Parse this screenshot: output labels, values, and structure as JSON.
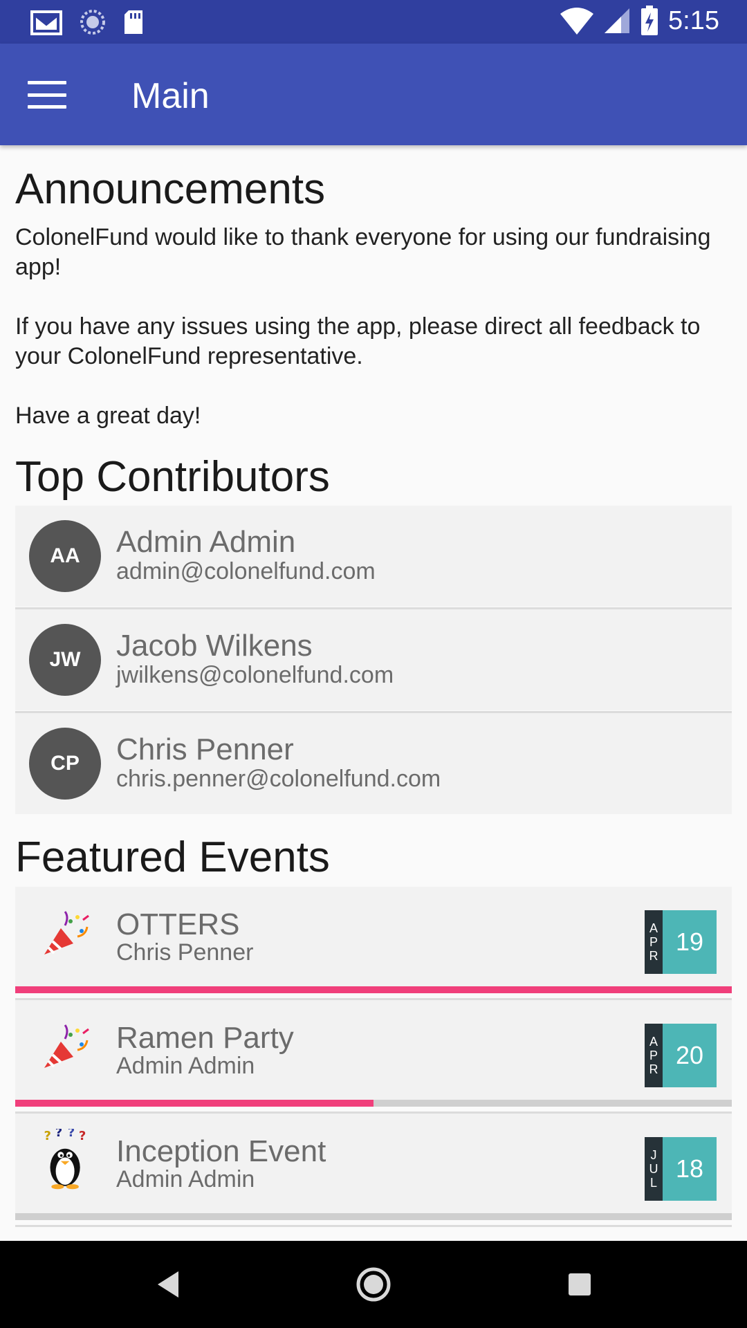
{
  "status_bar": {
    "time": "5:15",
    "icons": [
      "gmail-icon",
      "sync-icon",
      "sd-card-icon",
      "wifi-icon",
      "signal-icon",
      "battery-charging-icon"
    ]
  },
  "app_bar": {
    "title": "Main",
    "menu_icon": "hamburger-menu-icon",
    "bg_color": "#3f51b5",
    "status_bg_color": "#303f9f"
  },
  "announcements": {
    "title": "Announcements",
    "line1": "ColonelFund would like to thank everyone for using our fundraising app!",
    "line2": "If you have any issues using the app, please direct all feedback to your ColonelFund representative.",
    "line3": "Have a great day!"
  },
  "top_contributors": {
    "title": "Top Contributors",
    "items": [
      {
        "initials": "AA",
        "name": "Admin Admin",
        "email": "admin@colonelfund.com"
      },
      {
        "initials": "JW",
        "name": "Jacob Wilkens",
        "email": "jwilkens@colonelfund.com"
      },
      {
        "initials": "CP",
        "name": "Chris Penner",
        "email": "chris.penner@colonelfund.com"
      }
    ]
  },
  "featured_events": {
    "title": "Featured Events",
    "accent_color": "#f03f7b",
    "badge_color": "#4db6b6",
    "items": [
      {
        "name": "OTTERS",
        "organizer": "Chris Penner",
        "month": "APR",
        "day": "19",
        "progress": 1.0,
        "icon": "party-popper-icon"
      },
      {
        "name": "Ramen Party",
        "organizer": "Admin Admin",
        "month": "APR",
        "day": "20",
        "progress": 0.5,
        "icon": "party-popper-icon"
      },
      {
        "name": "Inception Event",
        "organizer": "Admin Admin",
        "month": "JUL",
        "day": "18",
        "progress": 0.0,
        "icon": "confused-penguin-icon"
      }
    ]
  },
  "nav_bar": {
    "icons": [
      "back-icon",
      "home-icon",
      "recents-icon"
    ]
  }
}
